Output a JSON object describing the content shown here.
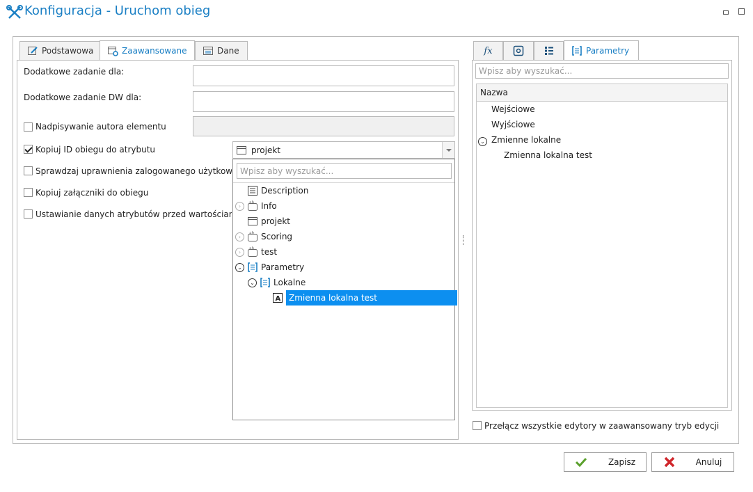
{
  "window": {
    "title": "Konfiguracja - Uruchom obieg"
  },
  "left_tabs": [
    {
      "label": "Podstawowa",
      "active": false
    },
    {
      "label": "Zaawansowane",
      "active": true
    },
    {
      "label": "Dane",
      "active": false
    }
  ],
  "form": {
    "extra_task_label": "Dodatkowe zadanie dla:",
    "extra_task_dw_label": "Dodatkowe zadanie DW dla:",
    "overwrite_author_label": "Nadpisywanie autora elementu",
    "copy_id_label": "Kopiuj ID obiegu do atrybutu",
    "check_permissions_label": "Sprawdzaj uprawnienia zalogowanego użytkownik",
    "copy_attachments_label": "Kopiuj załączniki do obiegu",
    "set_attributes_label": "Ustawianie danych atrybutów przed wartościami d",
    "overwrite_author_checked": false,
    "copy_id_checked": true,
    "check_permissions_checked": false,
    "copy_attachments_checked": false,
    "set_attributes_checked": false
  },
  "dropdown": {
    "selected": "projekt",
    "search_placeholder": "Wpisz aby wyszukać...",
    "items": [
      {
        "label": "Description",
        "icon": "list-icon"
      },
      {
        "label": "Info",
        "icon": "text-field-icon"
      },
      {
        "label": "projekt",
        "icon": "window-icon"
      },
      {
        "label": "Scoring",
        "icon": "text-field-icon"
      },
      {
        "label": "test",
        "icon": "text-field-icon"
      },
      {
        "label": "Parametry",
        "icon": "bracket-icon"
      },
      {
        "label": "Lokalne",
        "icon": "bracket-icon"
      },
      {
        "label": "Zmienna lokalna test",
        "icon": "letter-a-icon"
      }
    ]
  },
  "right_tabs": {
    "fx_icon": "fx",
    "parametry_label": "Parametry"
  },
  "right_panel": {
    "search_placeholder": "Wpisz aby wyszukać...",
    "column_header": "Nazwa",
    "items": [
      "Wejściowe",
      "Wyjściowe",
      "Zmienne lokalne",
      "Zmienna lokalna test"
    ]
  },
  "advanced_mode_label": "Przełącz wszystkie edytory w zaawansowany tryb edycji",
  "buttons": {
    "save": "Zapisz",
    "cancel": "Anuluj"
  },
  "colors": {
    "accent": "#1a7fc4",
    "selection": "#0c8ff0"
  }
}
